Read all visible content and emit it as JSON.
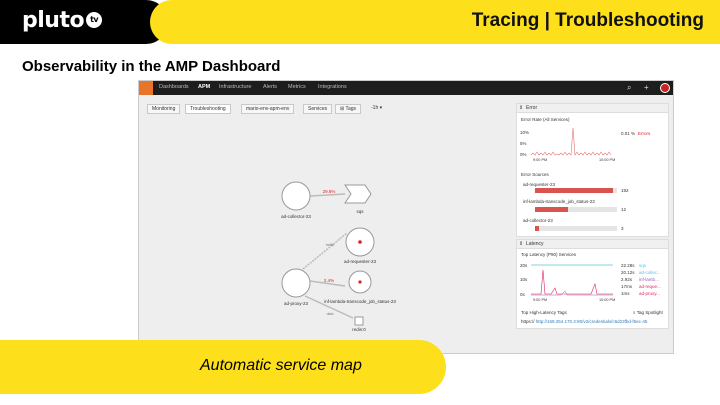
{
  "slide": {
    "logo_text": "pluto",
    "logo_badge": "tv",
    "title": "Tracing | Troubleshooting",
    "subtitle": "Observability in the AMP Dashboard",
    "caption": "Automatic service map"
  },
  "nav": {
    "items": [
      "Dashboards",
      "APM",
      "Infrastructure",
      "Alerts",
      "Metrics",
      "Integrations"
    ],
    "active": "APM"
  },
  "controls": {
    "tab_monitoring": "Monitoring",
    "tab_troubleshooting": "Troubleshooting",
    "environment": "mario-env-apm-env",
    "services": "Services",
    "tags": "Tags",
    "time": "-1h ▾"
  },
  "service_map": {
    "nodes": {
      "ad_collector": "ad-collector-23",
      "sqs": "sqs",
      "ad_requester": "ad-requester-23",
      "ad_proxy": "ad-proxy-23",
      "inf_lambda": "inf-lambda-transcode_job_status-23",
      "redis": "redis:0"
    },
    "edge_labels": {
      "collector_to_sqs": "29.8%",
      "proxy_to_lambda": "2.4%",
      "proxy_to_requester": "traffic",
      "proxy_to_redis": "data"
    }
  },
  "error_panel": {
    "header": "Error",
    "rate_title": "Error Rate (All Services)",
    "rate_value": "0.01 %",
    "rate_unit": "Errors",
    "y_ticks": [
      "0%",
      "5%",
      "10%"
    ],
    "x_ticks": [
      "9:00 PM",
      "10:00 PM"
    ],
    "sources_title": "Error Sources",
    "sources": [
      {
        "name": "ad-requester-23",
        "count": "192",
        "fraction": 0.95
      },
      {
        "name": "inf-lambda-transcode_job_status-23",
        "count": "12",
        "fraction": 0.4
      },
      {
        "name": "ad-collector-23",
        "count": "3",
        "fraction": 0.05
      }
    ],
    "bar_color": "#d9534f"
  },
  "latency_panel": {
    "header": "Latency",
    "title": "Top Latency (P90) Services",
    "legend": [
      {
        "value": "22.28s",
        "name": "sqs",
        "color": "#5bc0de"
      },
      {
        "value": "20.12s",
        "name": "ad-collec...",
        "color": "#5bc0de"
      },
      {
        "value": "2.92s",
        "name": "inf-lamb...",
        "color": "#9b59b6"
      },
      {
        "value": "17ms",
        "name": "ad-reque...",
        "color": "#e91e63"
      },
      {
        "value": "1ms",
        "name": "ad-proxy...",
        "color": "#e91e63"
      }
    ],
    "y_ticks": [
      "20s",
      "10s",
      "0s"
    ],
    "x_ticks": [
      "9:00 PM",
      "10:00 PM"
    ],
    "tags_title": "Top High-Latency Tags",
    "tag_spotlight": "Tag Spotlight",
    "tag_value": "https://",
    "tag_link": "http://169.254.170.2:80/v2/credentials/c6d23fbd-f5ec-45"
  }
}
